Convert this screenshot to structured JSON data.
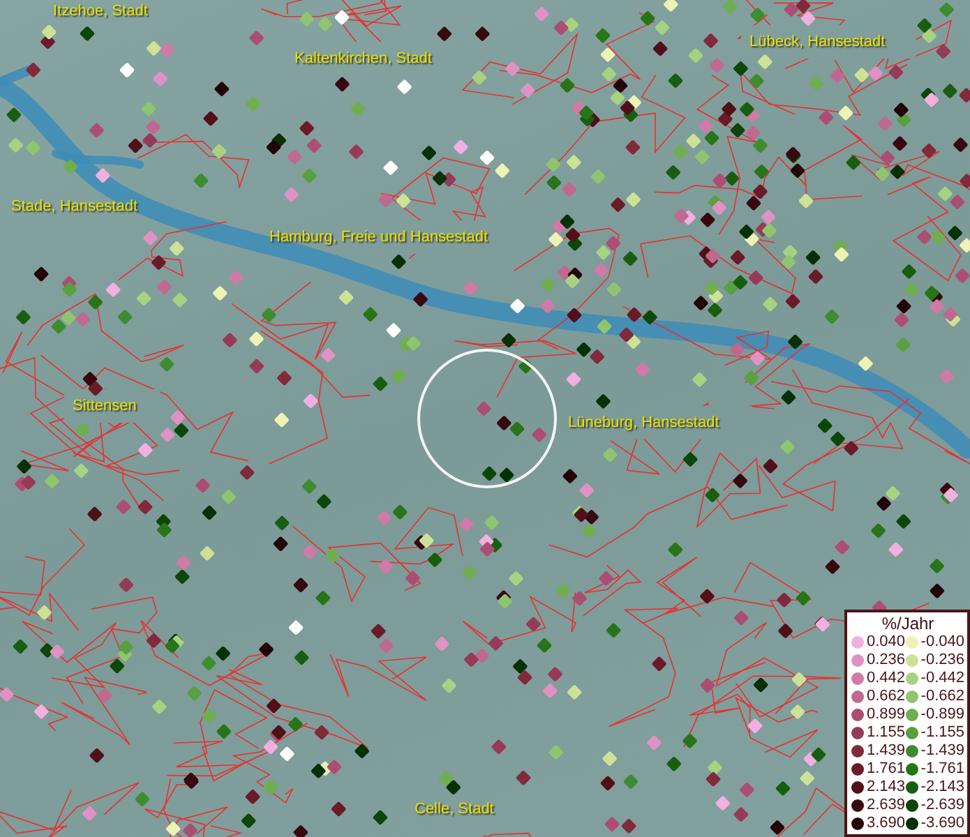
{
  "map": {
    "places": [
      {
        "name": "Itzehoe, Stadt"
      },
      {
        "name": "Kaltenkirchen, Stadt"
      },
      {
        "name": "Lübeck, Hansestadt"
      },
      {
        "name": "Stade, Hansestadt"
      },
      {
        "name": "Hamburg, Freie und Hansestadt"
      },
      {
        "name": "Sittensen"
      },
      {
        "name": "Lüneburg, Hansestadt"
      },
      {
        "name": "Celle, Stadt"
      }
    ]
  },
  "legend": {
    "title": "%/Jahr",
    "positive": [
      {
        "label": "0.040",
        "color": "#f0b0e0"
      },
      {
        "label": "0.236",
        "color": "#e092c4"
      },
      {
        "label": "0.442",
        "color": "#d07aa8"
      },
      {
        "label": "0.662",
        "color": "#c06890"
      },
      {
        "label": "0.899",
        "color": "#ac4e74"
      },
      {
        "label": "1.155",
        "color": "#963a5a"
      },
      {
        "label": "1.439",
        "color": "#802a3c"
      },
      {
        "label": "1.761",
        "color": "#6a1a28"
      },
      {
        "label": "2.143",
        "color": "#50101a"
      },
      {
        "label": "2.639",
        "color": "#380810"
      },
      {
        "label": "3.690",
        "color": "#220408"
      }
    ],
    "negative": [
      {
        "label": "-0.040",
        "color": "#eef2b4"
      },
      {
        "label": "-0.236",
        "color": "#cce296"
      },
      {
        "label": "-0.442",
        "color": "#a8d282"
      },
      {
        "label": "-0.662",
        "color": "#90c470"
      },
      {
        "label": "-0.899",
        "color": "#70ae50"
      },
      {
        "label": "-1.155",
        "color": "#58a040"
      },
      {
        "label": "-1.439",
        "color": "#3e8c30"
      },
      {
        "label": "-1.761",
        "color": "#287418"
      },
      {
        "label": "-2.143",
        "color": "#185e10"
      },
      {
        "label": "-2.639",
        "color": "#0c4608"
      },
      {
        "label": "-3.690",
        "color": "#063006"
      }
    ]
  }
}
